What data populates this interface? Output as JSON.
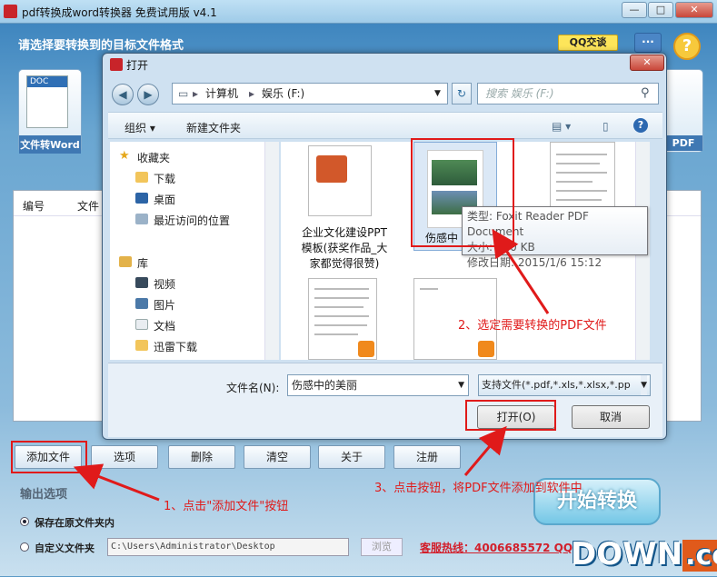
{
  "app": {
    "title": "pdf转换成word转换器 免费试用版 v4.1",
    "header_prompt": "请选择要转换到的目标文件格式",
    "qq_label": "QQ交谈",
    "menu_label": "···",
    "help_label": "?",
    "window_min": "—",
    "window_max": "□",
    "window_close": "✕",
    "format_cards": [
      {
        "badge": "DOC",
        "label": "文件转Word"
      },
      {
        "badge": "",
        "label": "PDF"
      }
    ],
    "list_headers": [
      "编号",
      "文件"
    ],
    "buttons": [
      "添加文件",
      "选项",
      "删除",
      "清空",
      "关于",
      "注册"
    ],
    "output_label": "输出选项",
    "opt_keep": "保存在原文件夹内",
    "opt_custom": "自定义文件夹",
    "custom_path": "C:\\Users\\Administrator\\Desktop",
    "browse_label": "浏览",
    "hotline": "客服热线：4006685572 QQ",
    "start_label": "开始转换",
    "watermark": "DOWN",
    "watermark_cc": ".cc"
  },
  "dialog": {
    "title": "打开",
    "close": "✕",
    "back": "◀",
    "forward": "▶",
    "address": [
      "计算机",
      "娱乐 (F:)"
    ],
    "address_sep": "▸",
    "refresh": "↻",
    "search_placeholder": "搜索 娱乐 (F:)",
    "organize": "组织 ▾",
    "new_folder": "新建文件夹",
    "nav_items": [
      {
        "label": "收藏夹",
        "icon": "star-icon"
      },
      {
        "label": "下载",
        "icon": "download-folder-icon"
      },
      {
        "label": "桌面",
        "icon": "desktop-icon"
      },
      {
        "label": "最近访问的位置",
        "icon": "recent-places-icon"
      },
      {
        "label": "库",
        "icon": "library-icon"
      },
      {
        "label": "视频",
        "icon": "video-icon"
      },
      {
        "label": "图片",
        "icon": "pictures-icon"
      },
      {
        "label": "文档",
        "icon": "documents-icon"
      },
      {
        "label": "迅雷下载",
        "icon": "folder-icon"
      }
    ],
    "files": [
      {
        "name_lines": [
          "企业文化建设PPT",
          "模板(获奖作品_大",
          "家都觉得很赞)"
        ]
      },
      {
        "name_lines": [
          "伤感中"
        ]
      },
      {
        "name_lines": [
          ""
        ]
      }
    ],
    "tooltip": {
      "type": "类型: Foxit Reader PDF Document",
      "size": "大小: 810 KB",
      "modified": "修改日期: 2015/1/6 15:12"
    },
    "filename_label": "文件名(N):",
    "filename_value": "伤感中的美丽",
    "filetype_value": "支持文件(*.pdf,*.xls,*.xlsx,*.pp",
    "open_button": "打开(O)",
    "cancel_button": "取消"
  },
  "annotations": {
    "step1": "1、点击\"添加文件\"按钮",
    "step2": "2、选定需要转换的PDF文件",
    "step3": "3、点击按钮，将PDF文件添加到软件中",
    "color": "#e01a1a"
  }
}
